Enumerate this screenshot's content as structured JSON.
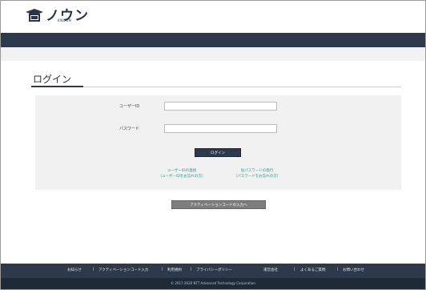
{
  "header": {
    "logo_text": "ノウン",
    "logo_sub": "KNOUN"
  },
  "page": {
    "title": "ログイン"
  },
  "form": {
    "user_id_label": "ユーザーID",
    "user_id_value": "",
    "password_label": "パスワード",
    "password_value": "",
    "login_button": "ログイン",
    "forgot_id_line1": "ユーザーIDの連絡",
    "forgot_id_line2": "（ユーザーIDをお忘れの方）",
    "forgot_pw_line1": "仮パスワードの発行",
    "forgot_pw_line2": "（パスワードをお忘れの方）"
  },
  "activation_button": "アクティベーションコードの入力へ",
  "footer": {
    "links": [
      "お知らせ",
      "|",
      "アクティベーションコード入力",
      "|",
      "利用規約",
      "|",
      "プライバシーポリシー",
      "運営会社",
      "|",
      "よくあるご質問",
      "|",
      "お問い合わせ"
    ],
    "copyright": "© 2017-2020 NTT Advanced Technology Corporation"
  },
  "colors": {
    "navy": "#2d3a4b",
    "link": "#2a9d8f",
    "panel": "#f1f1f1"
  }
}
